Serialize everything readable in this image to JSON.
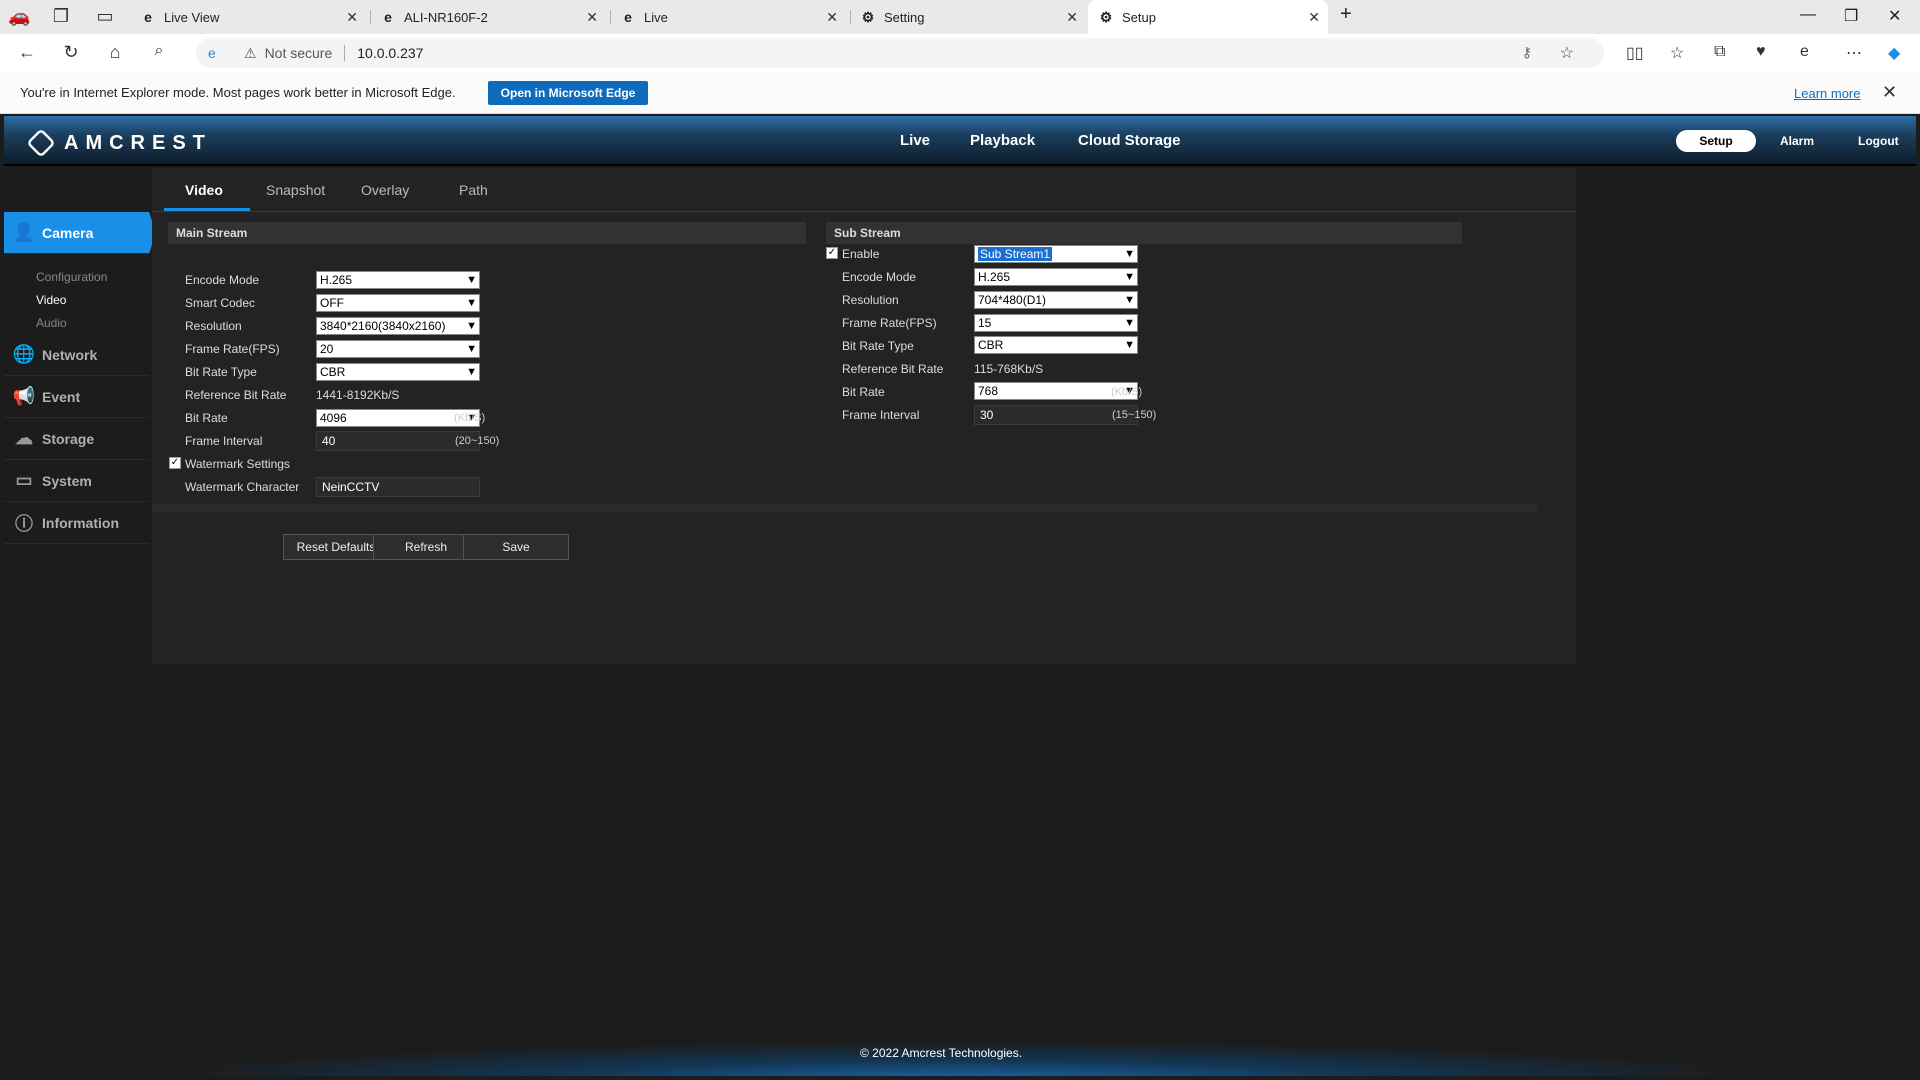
{
  "browser": {
    "tabs": [
      {
        "title": "Live View"
      },
      {
        "title": "ALI-NR160F-2"
      },
      {
        "title": "Live"
      },
      {
        "title": "Setting"
      },
      {
        "title": "Setup"
      }
    ],
    "security_label": "Not secure",
    "url": "10.0.0.237",
    "ie_mode_message": "You're in Internet Explorer mode. Most pages work better in Microsoft Edge.",
    "open_in_edge_label": "Open in Microsoft Edge",
    "learn_more_label": "Learn more"
  },
  "header": {
    "logo_text": "AMCREST",
    "nav": {
      "live": "Live",
      "playback": "Playback",
      "cloud": "Cloud Storage"
    },
    "setup": "Setup",
    "alarm": "Alarm",
    "logout": "Logout"
  },
  "sidebar": {
    "camera": "Camera",
    "camera_items": [
      "Configuration",
      "Video",
      "Audio"
    ],
    "network": "Network",
    "event": "Event",
    "storage": "Storage",
    "system": "System",
    "information": "Information"
  },
  "content_tabs": [
    "Video",
    "Snapshot",
    "Overlay",
    "Path"
  ],
  "main_stream": {
    "title": "Main Stream",
    "encode_mode_label": "Encode Mode",
    "encode_mode": "H.265",
    "smart_codec_label": "Smart Codec",
    "smart_codec": "OFF",
    "resolution_label": "Resolution",
    "resolution": "3840*2160(3840x2160)",
    "frame_rate_label": "Frame Rate(FPS)",
    "frame_rate": "20",
    "bit_rate_type_label": "Bit Rate Type",
    "bit_rate_type": "CBR",
    "ref_bit_rate_label": "Reference Bit Rate",
    "ref_bit_rate": "1441-8192Kb/S",
    "bit_rate_label": "Bit Rate",
    "bit_rate": "4096",
    "bit_rate_unit": "(Kb/S)",
    "frame_interval_label": "Frame Interval",
    "frame_interval": "40",
    "frame_interval_range": "(20~150)",
    "watermark_settings_label": "Watermark Settings",
    "watermark_char_label": "Watermark Character",
    "watermark_char": "NeinCCTV"
  },
  "sub_stream": {
    "title": "Sub Stream",
    "enable_label": "Enable",
    "stream": "Sub Stream1",
    "encode_mode_label": "Encode Mode",
    "encode_mode": "H.265",
    "resolution_label": "Resolution",
    "resolution": "704*480(D1)",
    "frame_rate_label": "Frame Rate(FPS)",
    "frame_rate": "15",
    "bit_rate_type_label": "Bit Rate Type",
    "bit_rate_type": "CBR",
    "ref_bit_rate_label": "Reference Bit Rate",
    "ref_bit_rate": "115-768Kb/S",
    "bit_rate_label": "Bit Rate",
    "bit_rate": "768",
    "bit_rate_unit": "(Kb/S)",
    "frame_interval_label": "Frame Interval",
    "frame_interval": "30",
    "frame_interval_range": "(15~150)"
  },
  "buttons": {
    "reset": "Reset Defaults",
    "refresh": "Refresh",
    "save": "Save"
  },
  "footer": "© 2022 Amcrest Technologies."
}
